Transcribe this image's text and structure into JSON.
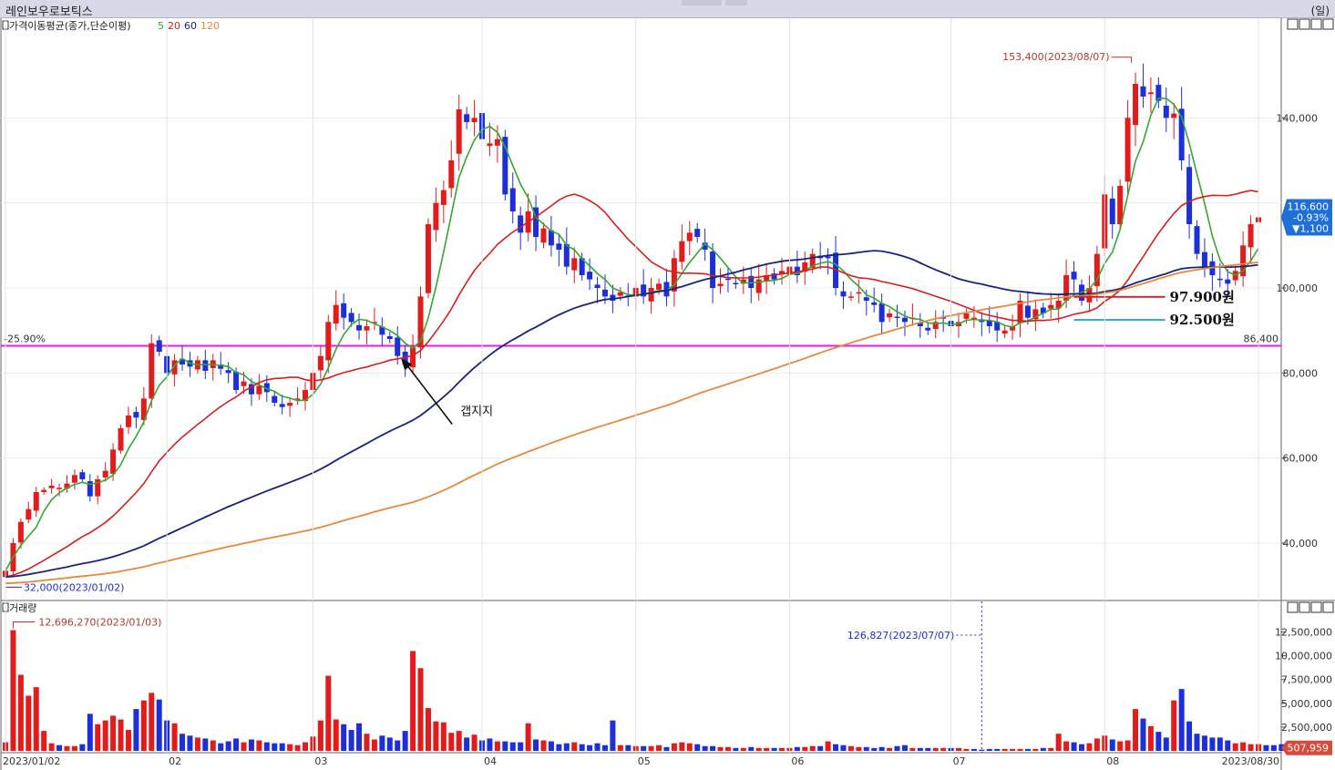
{
  "app": {
    "title": "레인보우로보틱스",
    "period": "(일)"
  },
  "colors": {
    "up": "#e31b1b",
    "down": "#1c2fd8",
    "ma5": "#33a833",
    "ma20": "#d81e1e",
    "ma60": "#1a237e",
    "ma120": "#e8893a",
    "support": "#e81ee8",
    "target_red": "#d81e1e",
    "target_cyan": "#1fa0bf",
    "price_badge": "#1f6fd8",
    "volume_badge": "#d84a3a"
  },
  "chart_data": [
    {
      "type": "candlestick",
      "panel_title": "가격이동평균(종가,단순이평)",
      "ma_legend": [
        "5",
        "20",
        "60",
        "120"
      ],
      "y_ticks": [
        40000,
        60000,
        80000,
        100000,
        140000
      ],
      "y_tick_labels": [
        "40,000",
        "60,000",
        "80,000",
        "100,000",
        "140,000"
      ],
      "ylim": [
        28000,
        160000
      ],
      "x_ticks": [
        {
          "label": "2023/01/02",
          "i": 0
        },
        {
          "label": "02",
          "i": 21
        },
        {
          "label": "03",
          "i": 40
        },
        {
          "label": "04",
          "i": 62
        },
        {
          "label": "05",
          "i": 82
        },
        {
          "label": "06",
          "i": 102
        },
        {
          "label": "07",
          "i": 123
        },
        {
          "label": "08",
          "i": 143
        },
        {
          "label": "2023/08/30",
          "i": 163
        }
      ],
      "high_marker": {
        "text": "153,400(2023/08/07)",
        "i": 146,
        "value": 153400
      },
      "low_marker": {
        "text": "32,000(2023/01/02)",
        "i": 0,
        "value": 32000
      },
      "support_line": {
        "value": 86400,
        "left_label": "-25.90%",
        "right_label": "86,400"
      },
      "targets": [
        {
          "label": "97.900원",
          "value": 97900,
          "from_i": 139,
          "color": "target_red"
        },
        {
          "label": "92.500원",
          "value": 92500,
          "from_i": 139,
          "color": "target_cyan"
        }
      ],
      "annotation": {
        "text": "갭지지",
        "i": 51,
        "value": 86400
      },
      "current_price": {
        "price": "116,600",
        "change_pct": "-0.93%",
        "change": "▼1,100"
      },
      "closes": [
        33500,
        40000,
        45000,
        48000,
        52000,
        52500,
        53500,
        53000,
        54000,
        56000,
        55000,
        51000,
        55000,
        57000,
        62000,
        67000,
        70000,
        69500,
        74000,
        87000,
        85000,
        80000,
        83000,
        82000,
        81500,
        83000,
        80500,
        83000,
        81000,
        80000,
        76000,
        78000,
        75000,
        77000,
        75500,
        73000,
        72000,
        73000,
        74000,
        76000,
        80000,
        84000,
        92000,
        96000,
        93000,
        92000,
        90000,
        91000,
        92000,
        89000,
        88000,
        84000,
        82000,
        86000,
        98000,
        115000,
        120000,
        123000,
        130000,
        142000,
        139000,
        140000,
        135000,
        134000,
        135000,
        122000,
        118000,
        113000,
        118000,
        112000,
        114000,
        110000,
        109000,
        105000,
        107000,
        103000,
        102000,
        100000,
        98000,
        97000,
        99000,
        98000,
        100000,
        98000,
        100000,
        101000,
        98000,
        107000,
        111000,
        113000,
        112000,
        109000,
        100000,
        101000,
        102000,
        101000,
        102000,
        100000,
        102000,
        103000,
        102000,
        104000,
        105000,
        103000,
        106000,
        108000,
        107000,
        107000,
        100000,
        98000,
        98000,
        99000,
        97000,
        96000,
        92000,
        94000,
        93000,
        92000,
        93000,
        91000,
        90000,
        92000,
        93000,
        91000,
        92000,
        94000,
        93000,
        92000,
        91000,
        90000,
        90000,
        91000,
        97000,
        93000,
        95000,
        94000,
        96000,
        97000,
        103000,
        102000,
        97000,
        100000,
        108000,
        122000,
        115000,
        124000,
        140000,
        148000,
        145000,
        146000,
        144000,
        140000,
        141000,
        130000,
        115000,
        108000,
        105000,
        103000,
        102000,
        101000,
        104000,
        110000,
        115000,
        116600
      ],
      "ma5": [],
      "ma20": [],
      "ma60": [],
      "ma120": []
    },
    {
      "type": "bar",
      "panel_title": "거래량",
      "y_ticks": [
        2500000,
        5000000,
        7500000,
        10000000,
        12500000
      ],
      "y_tick_labels": [
        "2,500,000",
        "5,000,000",
        "7,500,000",
        "10,000,000",
        "12,500,000"
      ],
      "ylim": [
        0,
        13800000
      ],
      "max_marker": {
        "text": "12,696,270(2023/01/03)",
        "i": 1,
        "value": 12696270
      },
      "min_marker": {
        "text": "126,827(2023/07/07)",
        "i": 127,
        "value": 126827
      },
      "current_volume": "507,959",
      "volumes": [
        900000,
        12696270,
        8000000,
        5800000,
        6700000,
        2100000,
        800000,
        600000,
        500000,
        500000,
        700000,
        3900000,
        2800000,
        3200000,
        3700000,
        3300000,
        2200000,
        4400000,
        5300000,
        6100000,
        5400000,
        3200000,
        2900000,
        1800000,
        1600000,
        1400000,
        1300000,
        1100000,
        800000,
        1000000,
        1300000,
        900000,
        1200000,
        1100000,
        900000,
        800000,
        800000,
        700000,
        600000,
        900000,
        1500000,
        3200000,
        7900000,
        3300000,
        2800000,
        2200000,
        2900000,
        1800000,
        1200000,
        1600000,
        1400000,
        1100000,
        2100000,
        10500000,
        8700000,
        4500000,
        3100000,
        3000000,
        1900000,
        2100000,
        1400000,
        1700000,
        1100000,
        1300000,
        1000000,
        1000000,
        900000,
        900000,
        2900000,
        1200000,
        1100000,
        1000000,
        700000,
        800000,
        900000,
        700000,
        600000,
        800000,
        600000,
        3200000,
        600000,
        600000,
        500000,
        500000,
        500000,
        600000,
        400000,
        800000,
        900000,
        800000,
        700000,
        500000,
        500000,
        400000,
        400000,
        300000,
        300000,
        400000,
        300000,
        300000,
        300000,
        300000,
        300000,
        400000,
        400000,
        500000,
        500000,
        1000000,
        700000,
        600000,
        500000,
        400000,
        400000,
        300000,
        400000,
        300000,
        500000,
        600000,
        300000,
        300000,
        300000,
        300000,
        300000,
        300000,
        300000,
        200000,
        200000,
        126827,
        200000,
        200000,
        200000,
        200000,
        200000,
        200000,
        200000,
        300000,
        300000,
        1800000,
        1000000,
        900000,
        700000,
        800000,
        1300000,
        1600000,
        1200000,
        1000000,
        1100000,
        4400000,
        3400000,
        2600000,
        2000000,
        1400000,
        5300000,
        6500000,
        3100000,
        1800000,
        1600000,
        1400000,
        1400000,
        1100000,
        800000,
        900000,
        700000,
        700000,
        600000,
        600000,
        700000,
        507959
      ]
    }
  ]
}
